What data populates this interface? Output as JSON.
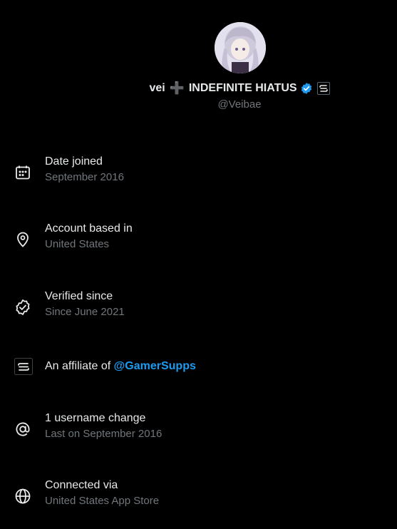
{
  "profile": {
    "display_name_prefix": "vei",
    "display_name_suffix": "INDEFINITE HIATUS",
    "handle": "@Veibae",
    "verified_badge_color": "#1d9bf0"
  },
  "details": [
    {
      "label": "Date joined",
      "sub": "September 2016",
      "icon": "calendar-icon"
    },
    {
      "label": "Account based in",
      "sub": "United States",
      "icon": "location-pin-icon"
    },
    {
      "label": "Verified since",
      "sub": "Since June 2021",
      "icon": "verified-outline-icon"
    },
    {
      "label": "An affiliate of",
      "link": "@GamerSupps",
      "icon": "affiliate-badge-icon"
    },
    {
      "label": "1 username change",
      "sub": "Last on September 2016",
      "icon": "at-sign-icon"
    },
    {
      "label": "Connected via",
      "sub": "United States App Store",
      "icon": "globe-icon"
    }
  ]
}
